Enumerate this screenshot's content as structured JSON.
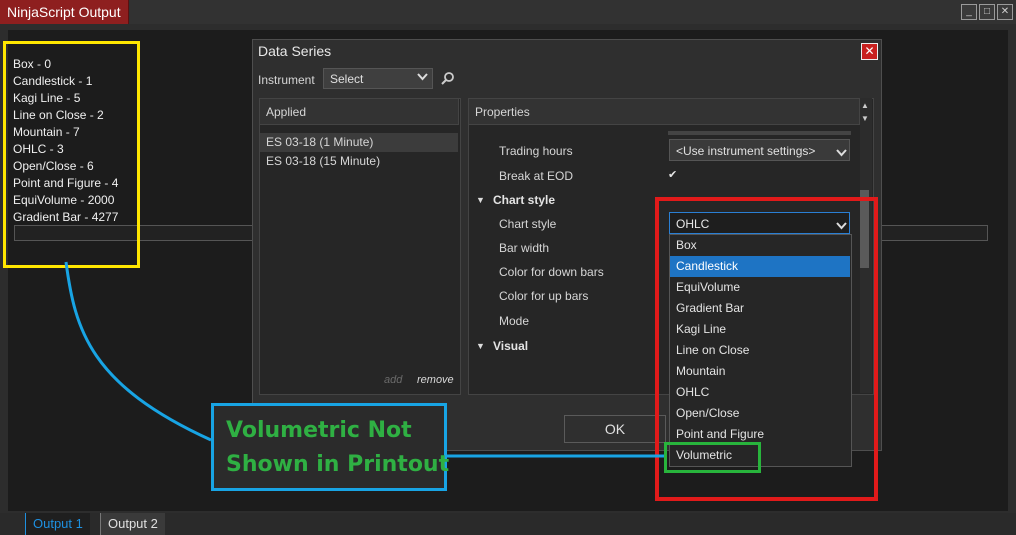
{
  "window": {
    "title": "NinjaScript Output",
    "controls": [
      "_",
      "□",
      "✕"
    ]
  },
  "output_lines": [
    "Box - 0",
    "Candlestick - 1",
    "Kagi Line - 5",
    "Line on Close - 2",
    "Mountain - 7",
    "OHLC - 3",
    "Open/Close - 6",
    "Point and Figure - 4",
    "EquiVolume - 2000",
    "Gradient Bar - 4277"
  ],
  "bottom_tabs": [
    "Output 1",
    "Output 2"
  ],
  "dialog": {
    "title": "Data Series",
    "instrument_label": "Instrument",
    "instrument_select": "Select",
    "applied_header": "Applied",
    "applied_series": [
      "ES 03-18 (1 Minute)",
      "ES 03-18 (15 Minute)"
    ],
    "add_label": "add",
    "remove_label": "remove",
    "properties_header": "Properties",
    "trading_hours_label": "Trading hours",
    "trading_hours_value": "<Use instrument settings>",
    "break_eod_label": "Break at EOD",
    "break_eod_checked": true,
    "chart_style_category": "Chart style",
    "chart_style_label": "Chart style",
    "bar_width_label": "Bar width",
    "color_down_label": "Color for down bars",
    "color_up_label": "Color for up bars",
    "mode_label": "Mode",
    "visual_category": "Visual",
    "ok_label": "OK"
  },
  "chart_style_dropdown": {
    "current": "OHLC",
    "options": [
      "Box",
      "Candlestick",
      "EquiVolume",
      "Gradient Bar",
      "Kagi Line",
      "Line on Close",
      "Mountain",
      "OHLC",
      "Open/Close",
      "Point and Figure",
      "Volumetric"
    ],
    "highlighted": "Candlestick"
  },
  "annotation": {
    "line1": "Volumetric Not",
    "line2": "Shown in Printout"
  },
  "colors": {
    "title_tab": "#8e1f1f",
    "highlight": "#1e74c4",
    "yellow_box": "#ffe600",
    "red_box": "#e11a1a",
    "green_box": "#28b43c",
    "blue_box": "#18a4e4",
    "callout_text": "#2fb043"
  }
}
